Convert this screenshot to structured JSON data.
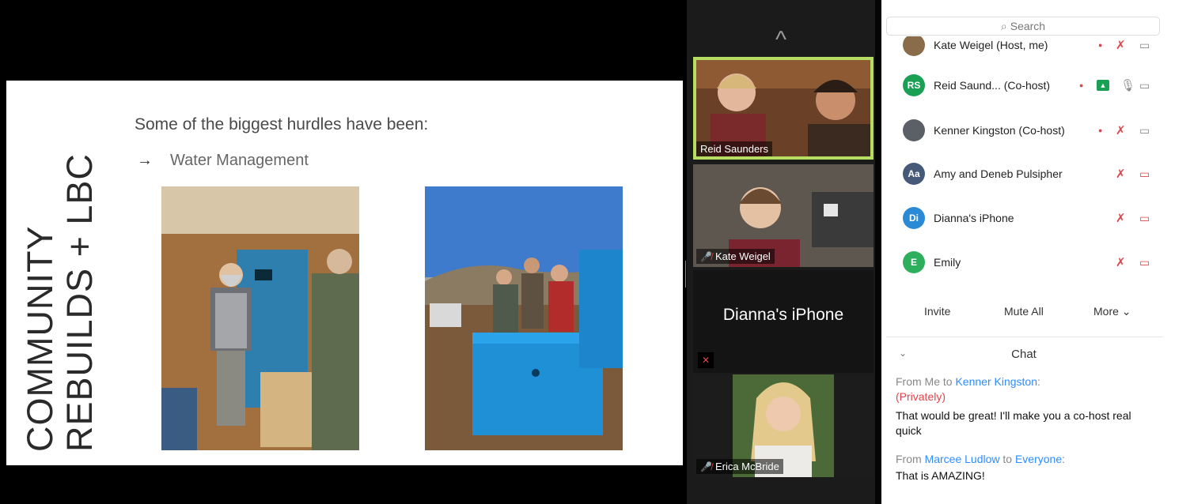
{
  "slide": {
    "title_line1": "COMMUNITY",
    "title_line2": "REBUILDS + LBC",
    "heading": "Some of the biggest hurdles have been:",
    "bullet": "Water Management",
    "bullet_arrow": "→"
  },
  "video_strip": {
    "scroll_up_icon": "^",
    "tiles": [
      {
        "name": "Reid Saunders",
        "active": true
      },
      {
        "name": "Kate Weigel",
        "muted": true
      },
      {
        "name": "Dianna's iPhone",
        "video": false,
        "muted": true
      },
      {
        "name": "Erica McBride",
        "muted": true
      }
    ]
  },
  "participants": {
    "search_placeholder": "Search",
    "items": [
      {
        "initials": "",
        "name": "Kate Weigel (Host, me)",
        "avatar_color": "#8a6b4a"
      },
      {
        "initials": "RS",
        "name": "Reid Saund... (Co-host)",
        "avatar_color": "#19a055"
      },
      {
        "initials": "",
        "name": "Kenner Kingston (Co-host)",
        "avatar_color": "#5b5f66"
      },
      {
        "initials": "Aa",
        "name": "Amy and Deneb Pulsipher",
        "avatar_color": "#445a78"
      },
      {
        "initials": "Di",
        "name": "Dianna's iPhone",
        "avatar_color": "#2b8ad6"
      },
      {
        "initials": "E",
        "name": "Emily",
        "avatar_color": "#2eaf5d"
      }
    ],
    "invite_label": "Invite",
    "mute_all_label": "Mute All",
    "more_label": "More ⌄"
  },
  "chat": {
    "title": "Chat",
    "collapse_icon": "⌄",
    "messages": [
      {
        "prefix": "From Me to ",
        "recipient": "Kenner Kingston",
        "suffix": ":",
        "private": "(Privately)",
        "text": "That would be great! I'll make you a co-host real quick"
      },
      {
        "prefix": "From ",
        "sender": "Marcee Ludlow",
        "middle": " to ",
        "recipient": "Everyone",
        "suffix": ":",
        "text": "That is AMAZING!"
      }
    ]
  },
  "colors": {
    "active_speaker": "#b6dd61",
    "muted_red": "#e0444a",
    "link_blue": "#2d8cff"
  }
}
